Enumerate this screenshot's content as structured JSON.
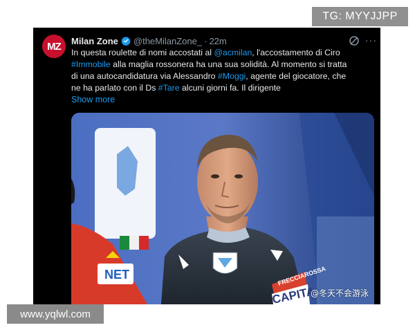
{
  "overlays": {
    "tg_label": "TG: MYYJJPP",
    "site_label": "www.yqlwl.com"
  },
  "tweet": {
    "avatar_text": "MZ",
    "display_name": "Milan Zone",
    "handle": "@theMilanZone_",
    "separator": "·",
    "time": "22m",
    "more_label": "···",
    "text": {
      "l1a": "In questa roulette di nomi accostati al ",
      "l1b": "@acmilan",
      "l1c": ", l'accostamento di Ciro",
      "l2a": "#Immobile",
      "l2b": " alla maglia rossonera ha una sua solidità. Al momento si tratta",
      "l3a": "di una autocandidatura via Alessandro ",
      "l3b": "#Moggi",
      "l3c": ", agente del giocatore, che",
      "l4a": "ne ha parlato con il Ds ",
      "l4b": "#Tare",
      "l4c": " alcuni giorni fa. Il dirigente"
    },
    "show_more": "Show more",
    "media": {
      "caption": "@冬天不会游泳",
      "armband_text": "CAPITA",
      "sleeve_text": "FRECCIAROSSA",
      "shirt_text": "NET"
    }
  },
  "colors": {
    "card_bg": "#000000",
    "link": "#1d9bf0",
    "text": "#e7e9ea",
    "muted": "#8b98a5",
    "avatar_bg": "#c8102e"
  }
}
